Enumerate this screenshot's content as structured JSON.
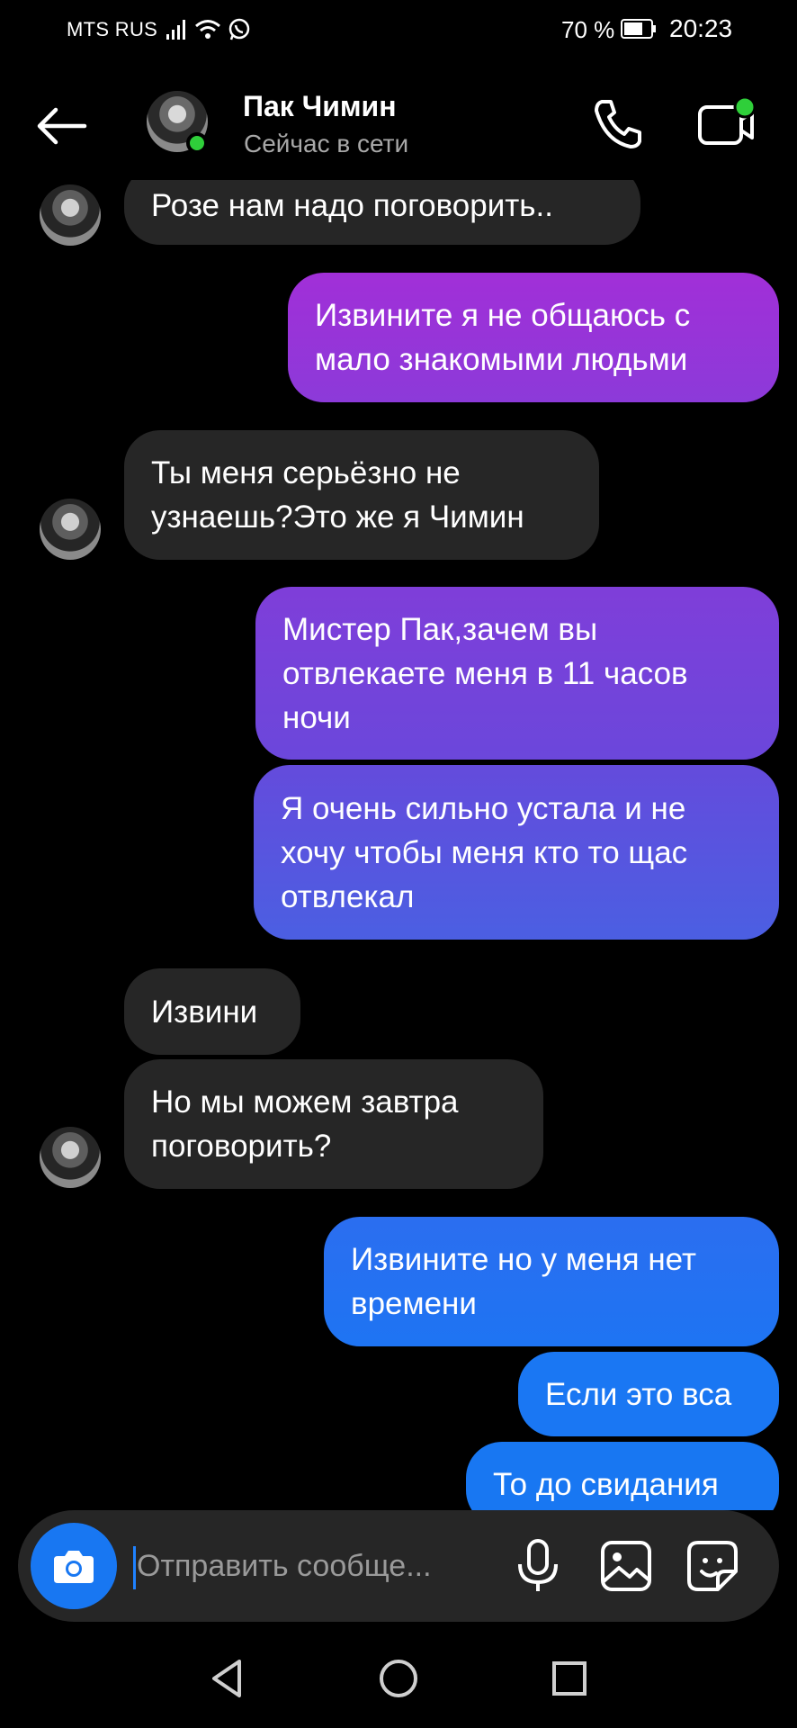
{
  "status_bar": {
    "carrier": "MTS RUS",
    "battery_percent": "70 %",
    "time": "20:23",
    "icons": [
      "signal-icon",
      "wifi-icon",
      "whatsapp-icon",
      "battery-icon"
    ]
  },
  "header": {
    "contact_name": "Пак Чимин",
    "contact_status": "Сейчас в сети",
    "online_color": "#2fcf3a",
    "icons": [
      "back-arrow-icon",
      "phone-icon",
      "video-camera-icon"
    ]
  },
  "messages": [
    {
      "sender": "them",
      "text": "Розе нам надо поговорить.."
    },
    {
      "sender": "me",
      "text": "Извините я не общаюсь с мало знакомыми людьми"
    },
    {
      "sender": "them",
      "text": "Ты меня серьёзно не узнаешь?Это же я Чимин"
    },
    {
      "sender": "me",
      "text": "Мистер Пак,зачем вы отвлекаете меня в 11 часов ночи"
    },
    {
      "sender": "me",
      "text": "Я очень сильно устала и не хочу чтобы меня кто то щас отвлекал"
    },
    {
      "sender": "them",
      "text": "Извини"
    },
    {
      "sender": "them",
      "text": "Но мы можем завтра поговорить?"
    },
    {
      "sender": "me",
      "text": "Извините но у меня нет времени"
    },
    {
      "sender": "me",
      "text": "Если это вса"
    },
    {
      "sender": "me",
      "text": "То до свидания"
    }
  ],
  "composer": {
    "placeholder": "Отправить сообще...",
    "icons": [
      "camera-icon",
      "microphone-icon",
      "gallery-icon",
      "sticker-icon"
    ],
    "accent_color": "#1877f2"
  },
  "colors": {
    "incoming_bubble": "#262626",
    "outgoing_gradient_top": "#a62fd6",
    "outgoing_gradient_mid": "#5a54e0",
    "outgoing_gradient_bottom": "#1877f2"
  },
  "nav_bar": {
    "icons": [
      "nav-back-icon",
      "nav-home-icon",
      "nav-recent-icon"
    ]
  }
}
